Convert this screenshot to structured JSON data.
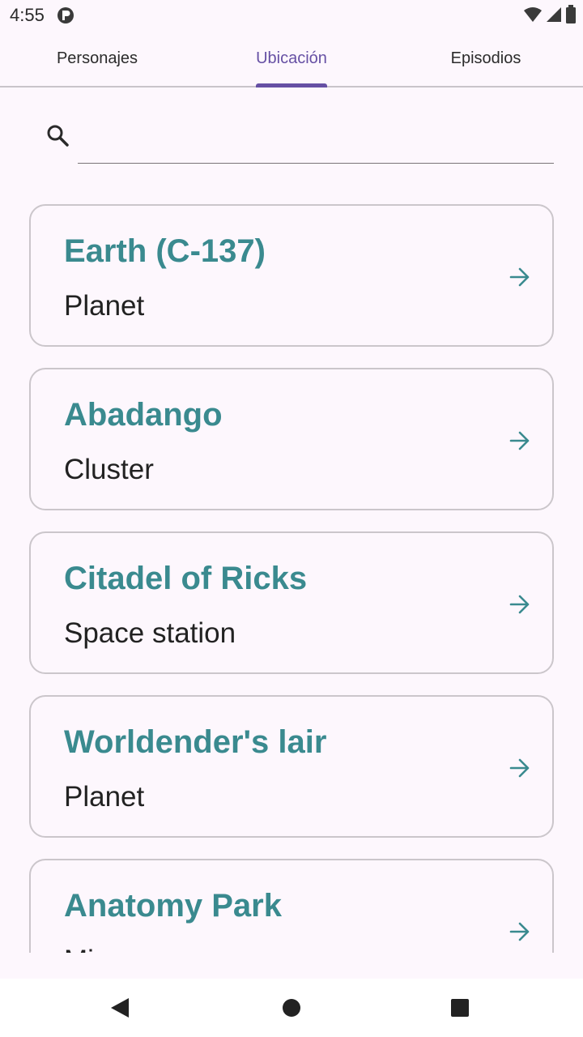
{
  "status_bar": {
    "time": "4:55",
    "app_icon": "app-notification-icon",
    "icons": [
      "wifi-icon",
      "signal-icon",
      "battery-icon"
    ]
  },
  "tabs": [
    {
      "label": "Personajes",
      "active": false
    },
    {
      "label": "Ubicación",
      "active": true
    },
    {
      "label": "Episodios",
      "active": false
    }
  ],
  "search": {
    "icon": "search-icon",
    "value": "",
    "placeholder": ""
  },
  "locations": [
    {
      "name": "Earth (C-137)",
      "type": "Planet"
    },
    {
      "name": "Abadango",
      "type": "Cluster"
    },
    {
      "name": "Citadel of Ricks",
      "type": "Space station"
    },
    {
      "name": "Worldender's lair",
      "type": "Planet"
    },
    {
      "name": "Anatomy Park",
      "type": "Mi"
    }
  ],
  "colors": {
    "accent": "#6650a4",
    "title": "#3a8a8f",
    "background": "#fdf7fd"
  },
  "nav_bar": [
    "back-icon",
    "home-icon",
    "recents-icon"
  ]
}
